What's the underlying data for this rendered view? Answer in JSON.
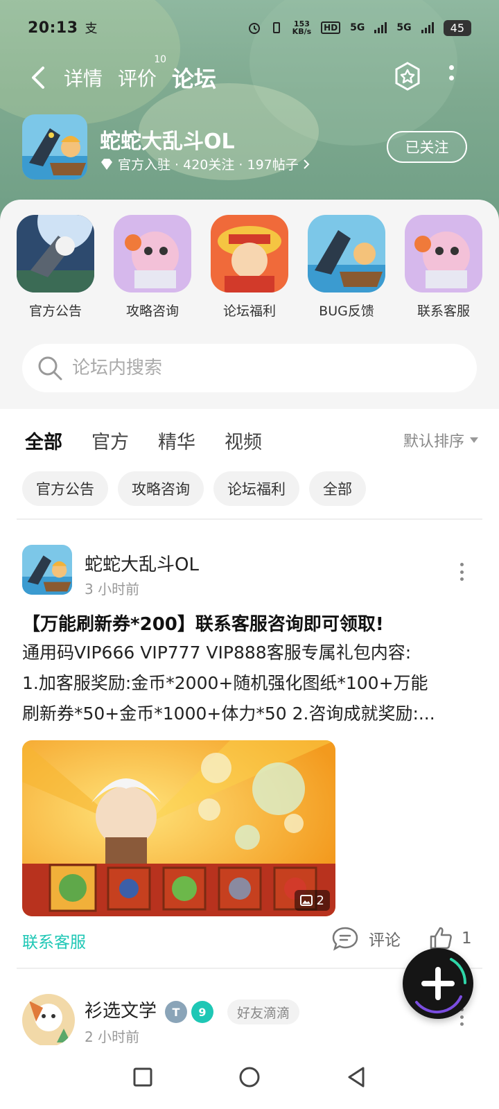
{
  "status_bar": {
    "time": "20:13",
    "notification": "支",
    "speed_value": "153",
    "speed_unit": "KB/s",
    "network_1": "5G",
    "network_2": "5G",
    "battery": "45"
  },
  "nav": {
    "tabs": [
      {
        "label": "详情"
      },
      {
        "label": "评价",
        "badge": "10"
      },
      {
        "label": "论坛"
      }
    ],
    "active_tab": "论坛"
  },
  "game": {
    "title": "蛇蛇大乱斗OL",
    "meta": "官方入驻 · 420关注 · 197帖子",
    "follow_label": "已关注"
  },
  "shortcuts": [
    {
      "label": "官方公告"
    },
    {
      "label": "攻略咨询"
    },
    {
      "label": "论坛福利"
    },
    {
      "label": "BUG反馈"
    },
    {
      "label": "联系客服"
    }
  ],
  "search": {
    "placeholder": "论坛内搜索"
  },
  "filter": {
    "tabs": [
      "全部",
      "官方",
      "精华",
      "视频"
    ],
    "active": "全部",
    "sort_label": "默认排序"
  },
  "chips": [
    "官方公告",
    "攻略咨询",
    "论坛福利",
    "全部"
  ],
  "post": {
    "author": "蛇蛇大乱斗OL",
    "time": "3 小时前",
    "title": "【万能刷新券*200】联系客服咨询即可领取!",
    "body_lines": [
      "通用码VIP666 VIP777 VIP888客服专属礼包内容:",
      "1.加客服奖励:金币*2000+随机强化图纸*100+万能",
      "刷新券*50+金币*1000+体力*50 2.咨询成就奖励:..."
    ],
    "image_count": "2",
    "link_label": "联系客服",
    "comment_label": "评论",
    "like_count": "1"
  },
  "post2": {
    "author": "衫选文学",
    "time": "2 小时前",
    "level_badge": "9",
    "tag": "好友滴滴"
  },
  "colors": {
    "accent": "#2fd6a8",
    "link": "#1ec7b5",
    "header_bg": "#7faa90"
  }
}
